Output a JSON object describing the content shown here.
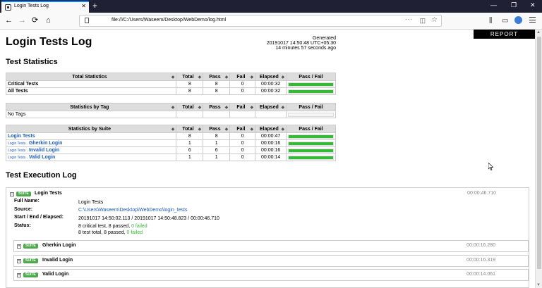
{
  "browser": {
    "tab_title": "Login Tests Log",
    "tab_close": "✕",
    "new_tab": "+",
    "window_controls": [
      "—",
      "❐",
      "✕"
    ],
    "nav_icons": [
      "←",
      "→",
      "⟳",
      "⌂"
    ],
    "url": "file:///C:/Users/Waseem/Desktop/WebDemo/log.html",
    "url_more": "···",
    "url_pocket": "◫",
    "url_star": "☆",
    "tool_icons": [
      "⫼",
      "▭"
    ]
  },
  "report_button": "REPORT",
  "page_title": "Login Tests Log",
  "generated": {
    "label": "Generated",
    "timestamp": "20191017 14:50:48 UTC+05:30",
    "ago": "14 minutes 57 seconds ago"
  },
  "sections": {
    "test_statistics": "Test Statistics",
    "execution_log": "Test Execution Log"
  },
  "stat_columns": {
    "total": "Total",
    "pass": "Pass",
    "fail": "Fail",
    "elapsed": "Elapsed",
    "passfail": "Pass / Fail",
    "sort": "◆"
  },
  "total_stats": {
    "header": "Total Statistics",
    "rows": [
      {
        "name": "Critical Tests",
        "total": "8",
        "pass": "8",
        "fail": "0",
        "elapsed": "00:00:32",
        "pass_ratio": 1
      },
      {
        "name": "All Tests",
        "total": "8",
        "pass": "8",
        "fail": "0",
        "elapsed": "00:00:32",
        "pass_ratio": 1
      }
    ]
  },
  "tag_stats": {
    "header": "Statistics by Tag",
    "rows": [
      {
        "name": "No Tags",
        "total": "",
        "pass": "",
        "fail": "",
        "elapsed": "",
        "pass_ratio": 0
      }
    ]
  },
  "suite_stats": {
    "header": "Statistics by Suite",
    "rows": [
      {
        "prefix": "",
        "name": "Login Tests",
        "total": "8",
        "pass": "8",
        "fail": "0",
        "elapsed": "00:00:47",
        "pass_ratio": 1
      },
      {
        "prefix": "Login Tests .",
        "name": "Gherkin Login",
        "total": "1",
        "pass": "1",
        "fail": "0",
        "elapsed": "00:00:16",
        "pass_ratio": 1
      },
      {
        "prefix": "Login Tests .",
        "name": "Invalid Login",
        "total": "6",
        "pass": "6",
        "fail": "0",
        "elapsed": "00:00:16",
        "pass_ratio": 1
      },
      {
        "prefix": "Login Tests .",
        "name": "Valid Login",
        "total": "1",
        "pass": "1",
        "fail": "0",
        "elapsed": "00:00:14",
        "pass_ratio": 1
      }
    ]
  },
  "execution": {
    "toggle": "–",
    "badge": "SUITE",
    "suite_name": "Login Tests",
    "elapsed": "00:00:46.710",
    "meta": {
      "full_name_label": "Full Name:",
      "full_name": "Login Tests",
      "source_label": "Source:",
      "source": "C:\\Users\\Waseem\\Desktop\\WebDemo\\login_tests",
      "times_label": "Start / End / Elapsed:",
      "times": "20191017 14:50:02.113 / 20191017 14:50:48.823 / 00:00:46.710",
      "status_label": "Status:",
      "status_line1_a": "8 critical test, 8 passed, ",
      "status_line1_b": "0 failed",
      "status_line2_a": "8 test total, 8 passed, ",
      "status_line2_b": "0 failed"
    },
    "children": [
      {
        "toggle": "+",
        "badge": "SUITE",
        "name": "Gherkin Login",
        "elapsed": "00:00:16.280"
      },
      {
        "toggle": "+",
        "badge": "SUITE",
        "name": "Invalid Login",
        "elapsed": "00:00:16.319"
      },
      {
        "toggle": "+",
        "badge": "SUITE",
        "name": "Valid Login",
        "elapsed": "00:00:14.061"
      }
    ]
  },
  "scrollbar": {
    "up": "▲",
    "down": "▼"
  }
}
